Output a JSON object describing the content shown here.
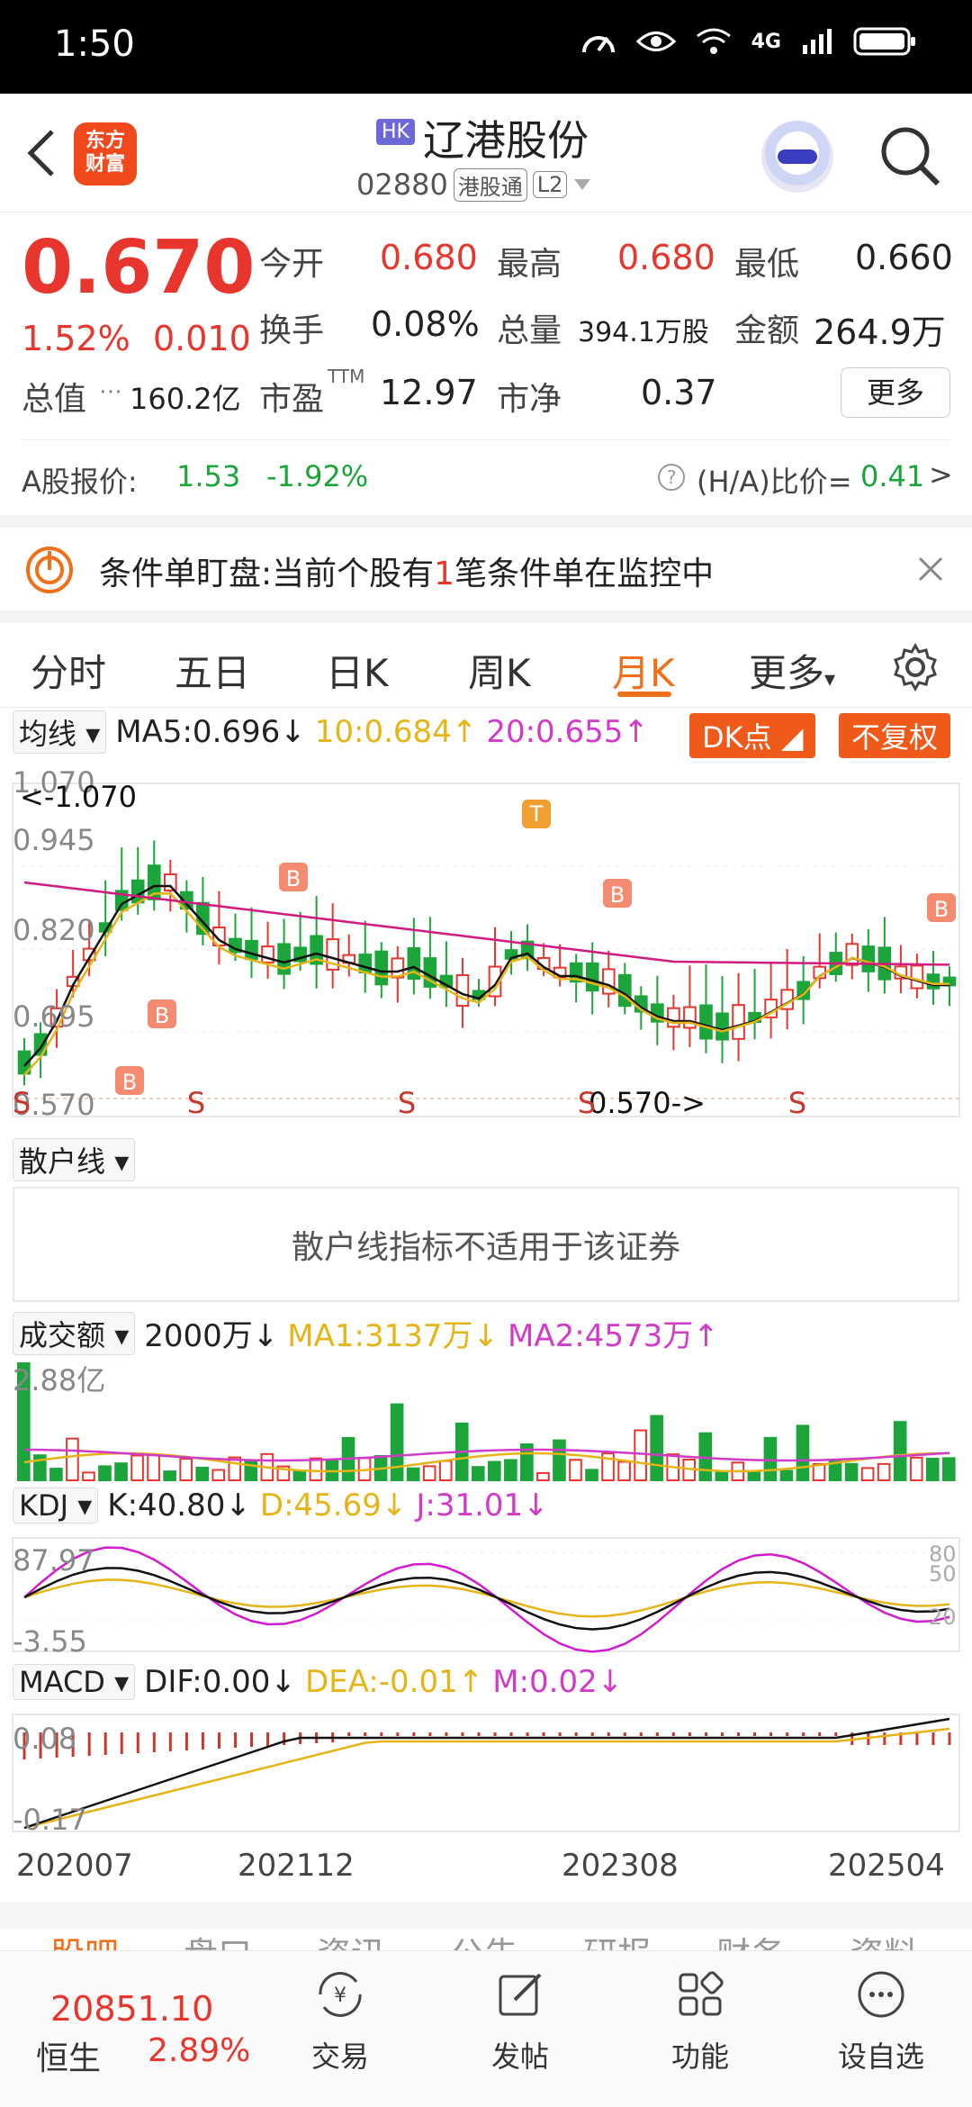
{
  "status_bar": {
    "time": "1:50",
    "network": "4G"
  },
  "header": {
    "market_badge": "HK",
    "stock_name": "辽港股份",
    "stock_code": "02880",
    "tag1": "港股通",
    "tag2": "L2",
    "logo_text_line1": "东方",
    "logo_text_line2": "财富"
  },
  "quote": {
    "price": "0.670",
    "change_pct": "1.52%",
    "change_amt": "0.010",
    "open_label": "今开",
    "open": "0.680",
    "high_label": "最高",
    "high": "0.680",
    "low_label": "最低",
    "low": "0.660",
    "turnover_label": "换手",
    "turnover": "0.08%",
    "volume_label": "总量",
    "volume": "394.1万股",
    "amount_label": "金额",
    "amount": "264.9万",
    "mktcap_label": "总值",
    "mktcap": "160.2亿",
    "pe_label": "市盈",
    "pe_sup": "TTM",
    "pe": "12.97",
    "pb_label": "市净",
    "pb": "0.37",
    "more": "更多"
  },
  "ashare": {
    "label": "A股报价:",
    "price": "1.53",
    "pct": "-1.92%",
    "ha_label": "(H/A)比价=",
    "ha_value": "0.41",
    "arrow": ">"
  },
  "condition": {
    "title": "条件单盯盘:",
    "text_pre": "当前个股有",
    "count": "1",
    "text_post": "笔条件单在监控中"
  },
  "tabs": [
    "分时",
    "五日",
    "日K",
    "周K",
    "月K",
    "更多"
  ],
  "active_tab": 4,
  "ma_bar": {
    "selector": "均线",
    "ma5": "MA5:0.696",
    "ma10": "10:0.684",
    "ma20": "20:0.655",
    "dk": "DK点",
    "fq": "不复权"
  },
  "kline": {
    "y_top": "1.070",
    "y2": "0.945",
    "y3": "0.820",
    "y4": "0.695",
    "y_bottom": "0.570",
    "max_label": "<-1.070",
    "min_label": "0.570->"
  },
  "retail": {
    "selector": "散户线",
    "message": "散户线指标不适用于该证券"
  },
  "volume_ind": {
    "selector": "成交额",
    "unit": "2000万",
    "ma1": "MA1:3137万",
    "ma2": "MA2:4573万",
    "top": "2.88亿"
  },
  "kdj": {
    "selector": "KDJ",
    "k": "K:40.80",
    "d": "D:45.69",
    "j": "J:31.01",
    "top": "87.97",
    "bottom": "-3.55",
    "r80": "80",
    "r50": "50",
    "r20": "20"
  },
  "macd": {
    "selector": "MACD",
    "dif": "DIF:0.00",
    "dea": "DEA:-0.01",
    "m": "M:0.02",
    "top": "0.08",
    "bottom": "-0.17"
  },
  "x_axis": [
    "202007",
    "202112",
    "202308",
    "202504"
  ],
  "bottom_tabs_partial": [
    "股吧",
    "盘口",
    "资讯",
    "公告",
    "研报",
    "财务",
    "资料"
  ],
  "nav": {
    "index_value": "20851.10",
    "index_name": "恒生",
    "index_pct": "2.89%",
    "items": [
      "交易",
      "发帖",
      "功能",
      "设自选"
    ]
  }
}
